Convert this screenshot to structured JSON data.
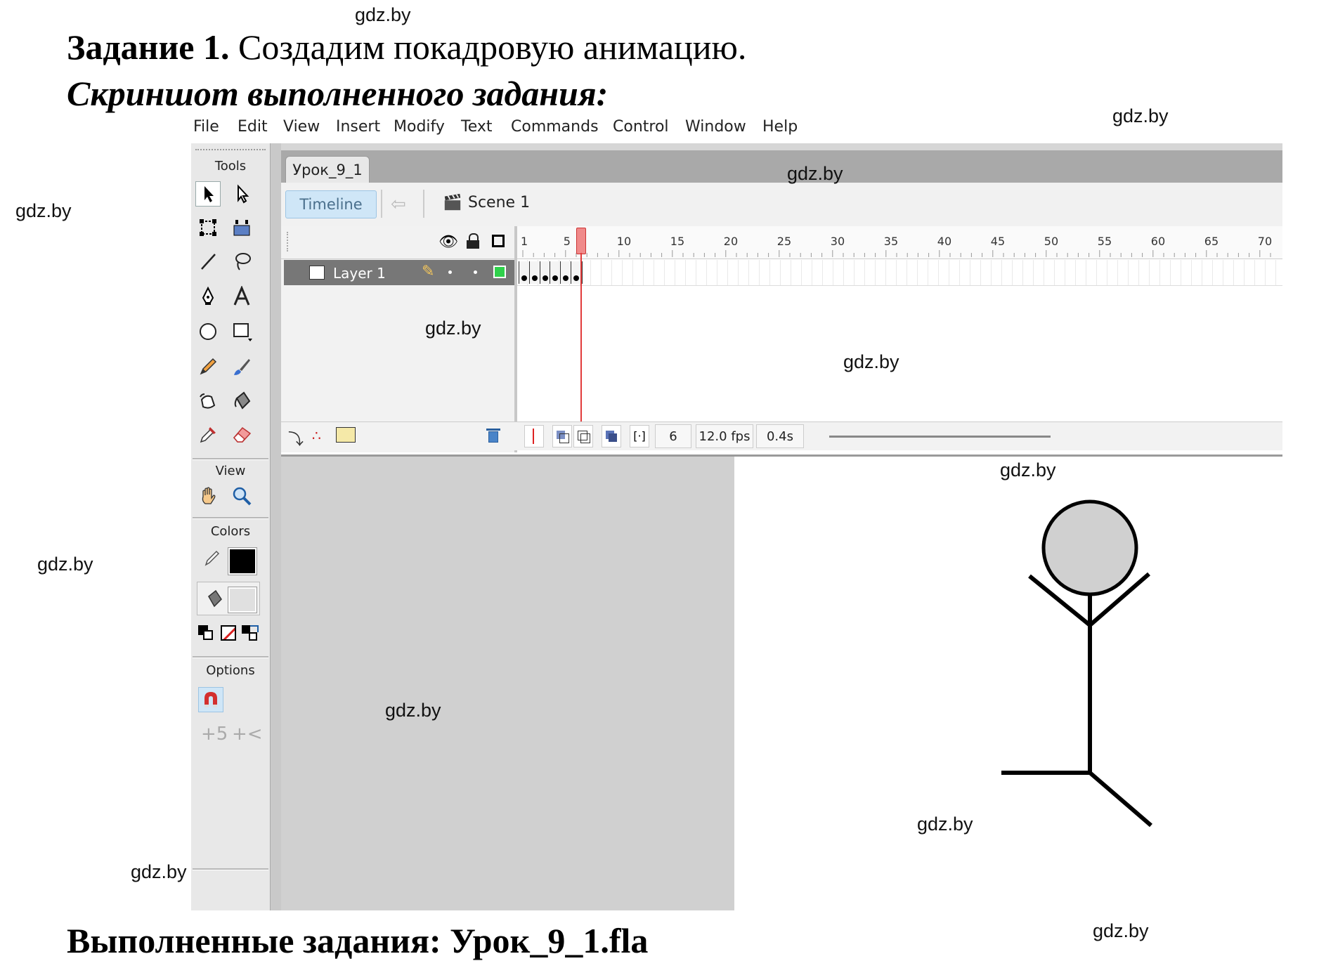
{
  "heading": {
    "task_bold": "Задание 1.",
    "task_text": " Создадим покадровую анимацию.",
    "screenshot_label": "Скриншот выполненного задания:",
    "footer": "Выполненные задания: Урок_9_1.fla"
  },
  "watermark": "gdz.by",
  "menu": [
    "File",
    "Edit",
    "View",
    "Insert",
    "Modify",
    "Text",
    "Commands",
    "Control",
    "Window",
    "Help"
  ],
  "tools_panel": {
    "tools_title": "Tools",
    "view_title": "View",
    "colors_title": "Colors",
    "options_title": "Options",
    "tools": [
      "selection-tool",
      "subselection-tool",
      "free-transform-tool",
      "gradient-transform-tool",
      "line-tool",
      "lasso-tool",
      "pen-tool",
      "text-tool",
      "oval-tool",
      "rectangle-tool",
      "pencil-tool",
      "brush-tool",
      "ink-bottle-tool",
      "paint-bucket-tool",
      "eyedropper-tool",
      "eraser-tool"
    ],
    "stroke_color": "#000000",
    "fill_color": "#e0e0e0"
  },
  "document": {
    "tab": "Урок_9_1",
    "timeline_button": "Timeline",
    "scene": "Scene 1"
  },
  "timeline": {
    "layer_name": "Layer 1",
    "ruler_labels": [
      "1",
      "5",
      "10",
      "15",
      "20",
      "25",
      "30",
      "35",
      "40",
      "45",
      "50",
      "55",
      "60",
      "65",
      "70"
    ],
    "keyframes": 6,
    "current_frame": "6",
    "frame_rate": "12.0 fps",
    "elapsed": "0.4s"
  },
  "stage": {
    "figure": "stick-figure",
    "head_fill": "#d0d0d0"
  }
}
